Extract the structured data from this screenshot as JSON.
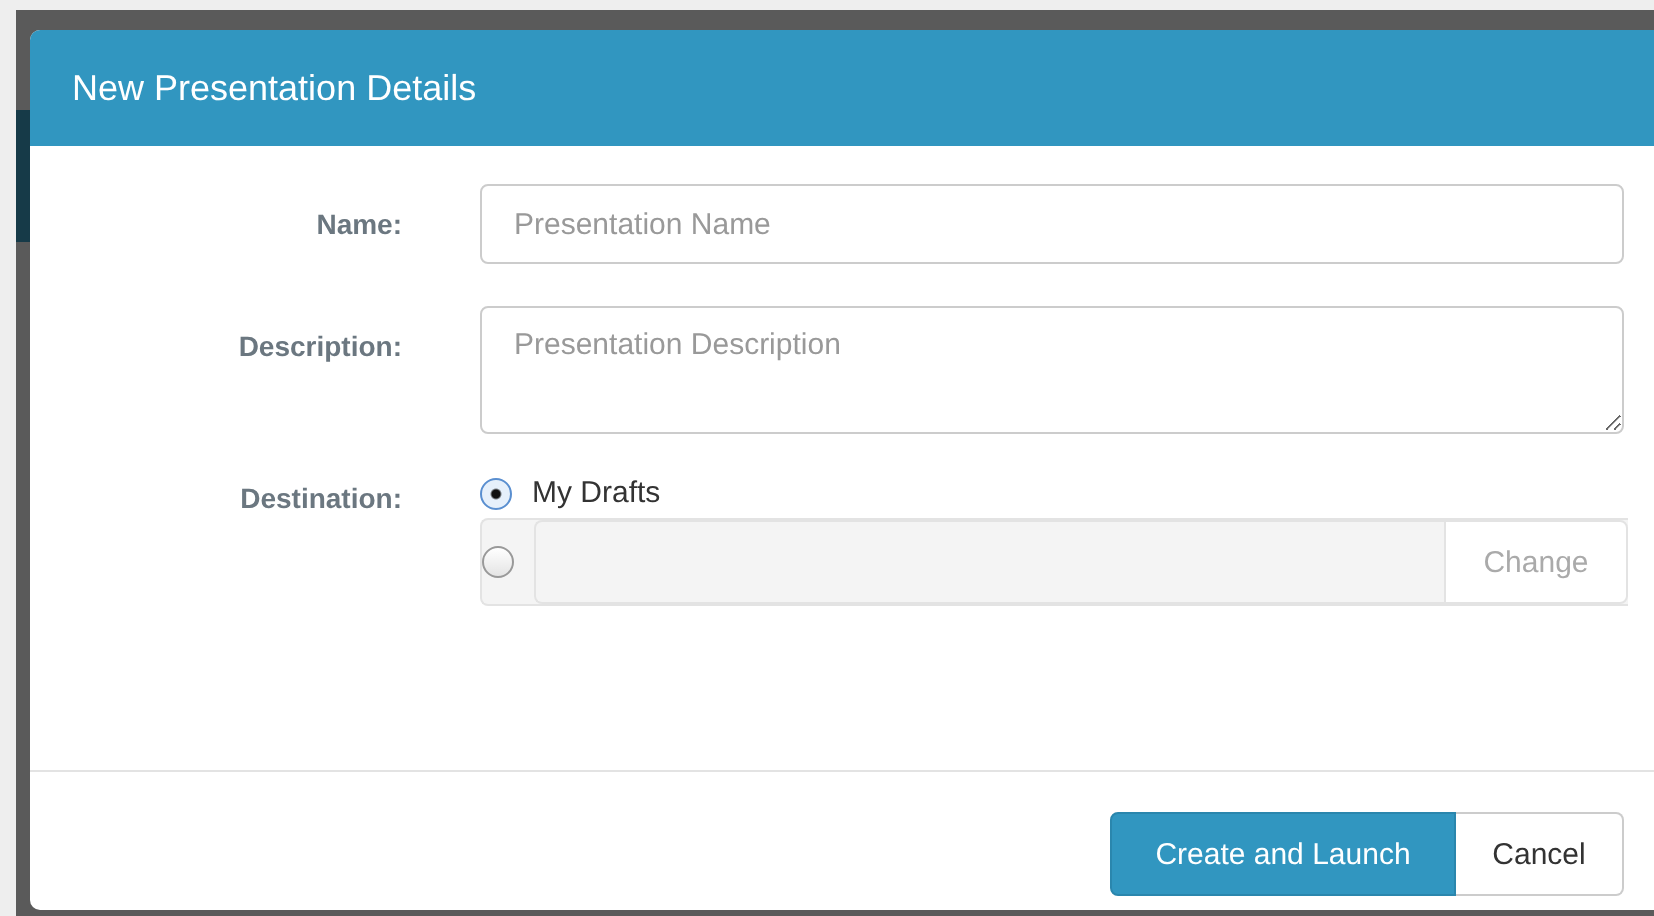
{
  "dialog": {
    "title": "New Presentation Details",
    "fields": [
      {
        "kind": "input",
        "label": "Name:",
        "placeholder": "Presentation Name"
      },
      {
        "kind": "textarea",
        "label": "Description:",
        "placeholder": "Presentation Description"
      }
    ],
    "destination": {
      "label": "Destination:",
      "options": [
        {
          "kind": "label",
          "label": "My Drafts",
          "selected": true
        },
        {
          "kind": "folder",
          "selected": false,
          "button": "Change"
        }
      ]
    },
    "buttons": [
      {
        "kind": "primary",
        "label": "Create and Launch"
      },
      {
        "kind": "default",
        "label": "Cancel"
      }
    ]
  }
}
